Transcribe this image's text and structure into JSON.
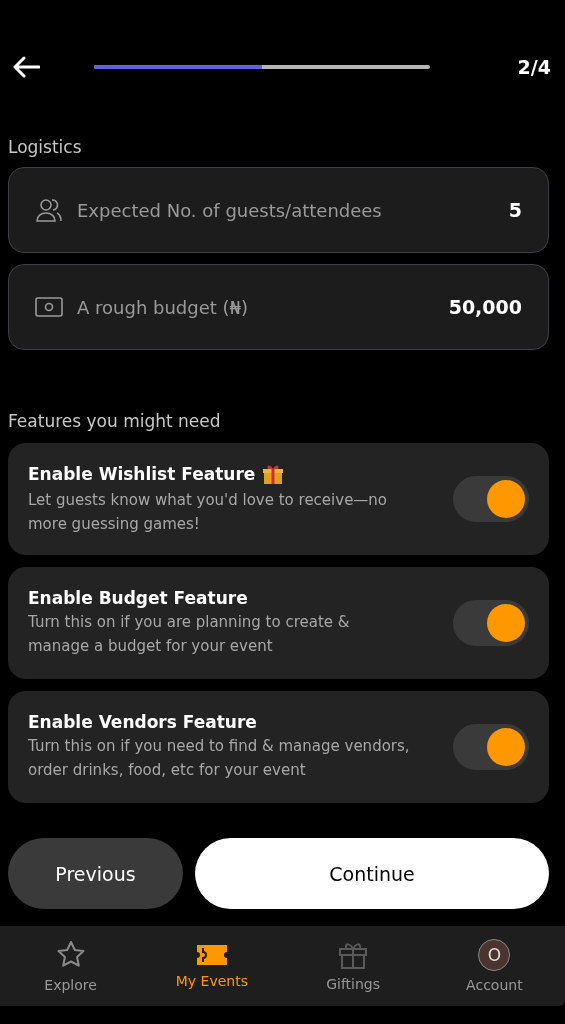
{
  "header": {
    "progress": {
      "level": 0.5
    },
    "step": "2/4"
  },
  "logistics": {
    "title": "Logistics",
    "fields": [
      {
        "kind": "guests",
        "label": "Expected No. of guests/attendees",
        "value": "5"
      },
      {
        "kind": "budget",
        "label": "A rough budget (₦)",
        "value": "50,000"
      }
    ]
  },
  "features": {
    "title": "Features you might need",
    "items": [
      {
        "title": "Enable Wishlist Feature",
        "gift": true,
        "description": "Let guests know what you'd love to receive—no more guessing games!",
        "on": true
      },
      {
        "title": "Enable Budget Feature",
        "gift": false,
        "description": "Turn this on if you are planning to create & manage a budget for your event",
        "on": true
      },
      {
        "title": "Enable Vendors Feature",
        "gift": false,
        "description": "Turn this on if you need to find & manage vendors, order drinks, food, etc for your event",
        "on": true
      }
    ]
  },
  "buttons": {
    "previous": "Previous",
    "continue": "Continue"
  },
  "nav": [
    {
      "kind": "star",
      "label": "Explore",
      "selected": false
    },
    {
      "kind": "ticket",
      "label": "My Events",
      "selected": true
    },
    {
      "kind": "gift",
      "label": "Giftings",
      "selected": false
    },
    {
      "kind": "avatar",
      "label": "Account",
      "initial": "O",
      "selected": false
    }
  ]
}
